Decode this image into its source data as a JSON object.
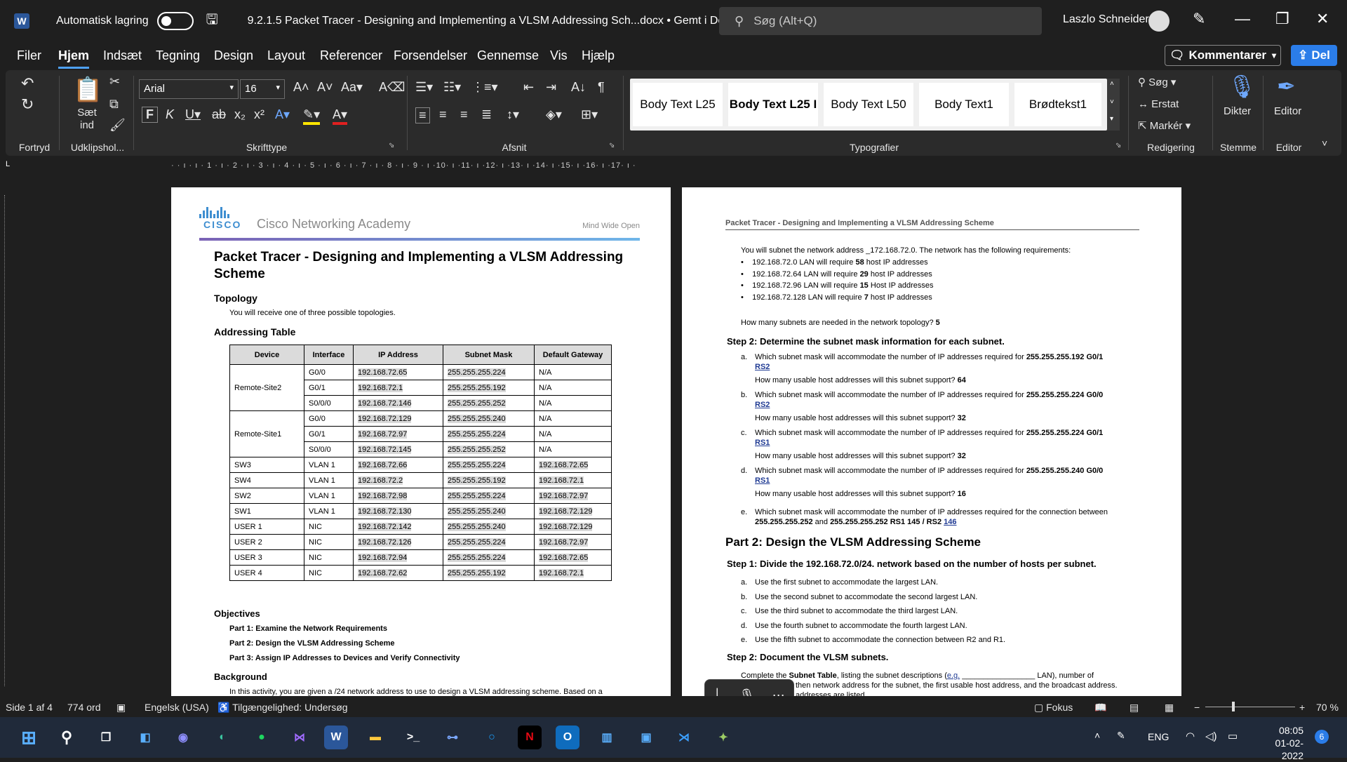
{
  "titlebar": {
    "autosave": "Automatisk lagring",
    "doc_title": "9.2.1.5 Packet Tracer - Designing and Implementing a VLSM Addressing Sch...docx • Gemt i Denne pc",
    "search_placeholder": "Søg (Alt+Q)",
    "user": "Laszlo Schneider"
  },
  "menu": {
    "tabs": [
      "Filer",
      "Hjem",
      "Indsæt",
      "Tegning",
      "Design",
      "Layout",
      "Referencer",
      "Forsendelser",
      "Gennemse",
      "Vis",
      "Hjælp"
    ],
    "comments": "Kommentarer",
    "share": "Del"
  },
  "ribbon": {
    "groups": {
      "undo": "Fortryd",
      "clipboard": "Udklipshol...",
      "font": "Skrifttype",
      "paragraph": "Afsnit",
      "styles": "Typografier",
      "editing": "Redigering",
      "voice": "Stemme",
      "editor": "Editor"
    },
    "paste": "Sæt ind",
    "font_name": "Arial",
    "font_size": "16",
    "styles": [
      "Body Text L25",
      "Body Text L25 I",
      "Body Text L50",
      "Body Text1",
      "Brødtekst1"
    ],
    "find": "Søg",
    "replace": "Erstat",
    "select": "Markér",
    "dictate": "Dikter",
    "editor_btn": "Editor"
  },
  "ruler": {
    "h": "· · ı · ı · 1 · ı · 2 · ı · 3 · ı · 4 · ı · 5 · ı · 6 · ı · 7 · ı · 8 · ı · 9 · ı ·10· ı ·11· ı ·12· ı ·13· ı ·14· ı ·15· ı ·16· ı ·17· ı ·"
  },
  "page1": {
    "brand": "CISCO",
    "academy": "Cisco Networking Academy",
    "mwo": "Mind Wide Open",
    "title": "Packet Tracer - Designing and Implementing a VLSM Addressing Scheme",
    "topology_h": "Topology",
    "topology_t": "You will receive one of three possible topologies.",
    "addr_h": "Addressing Table",
    "table": {
      "headers": [
        "Device",
        "Interface",
        "IP Address",
        "Subnet Mask",
        "Default Gateway"
      ],
      "rows": [
        {
          "device": "Remote-Site2",
          "interface": "G0/0",
          "ip": "192.168.72.65",
          "mask": "255.255.255.224",
          "gw": "N/A"
        },
        {
          "device": "",
          "interface": "G0/1",
          "ip": "192.168.72.1",
          "mask": "255.255.255.192",
          "gw": "N/A"
        },
        {
          "device": "",
          "interface": "S0/0/0",
          "ip": "192.168.72.146",
          "mask": "255.255.255.252",
          "gw": "N/A"
        },
        {
          "device": "Remote-Site1",
          "interface": "G0/0",
          "ip": "192.168.72.129",
          "mask": "255.255.255.240",
          "gw": "N/A"
        },
        {
          "device": "",
          "interface": "G0/1",
          "ip": "192.168.72.97",
          "mask": "255.255.255.224",
          "gw": "N/A"
        },
        {
          "device": "",
          "interface": "S0/0/0",
          "ip": "192.168.72.145",
          "mask": "255.255.255.252",
          "gw": "N/A"
        },
        {
          "device": "SW3",
          "interface": "VLAN 1",
          "ip": "192.168.72.66",
          "mask": "255.255.255.224",
          "gw": "192.168.72.65"
        },
        {
          "device": "SW4",
          "interface": "VLAN 1",
          "ip": "192.168.72.2",
          "mask": "255.255.255.192",
          "gw": "192.168.72.1"
        },
        {
          "device": "SW2",
          "interface": "VLAN 1",
          "ip": "192.168.72.98",
          "mask": "255.255.255.224",
          "gw": "192.168.72.97"
        },
        {
          "device": "SW1",
          "interface": "VLAN 1",
          "ip": "192.168.72.130",
          "mask": "255.255.255.240",
          "gw": "192.168.72.129"
        },
        {
          "device": "USER 1",
          "interface": "NIC",
          "ip": "192.168.72.142",
          "mask": "255.255.255.240",
          "gw": "192.168.72.129"
        },
        {
          "device": "USER 2",
          "interface": "NIC",
          "ip": "192.168.72.126",
          "mask": "255.255.255.224",
          "gw": "192.168.72.97"
        },
        {
          "device": "USER 3",
          "interface": "NIC",
          "ip": "192.168.72.94",
          "mask": "255.255.255.224",
          "gw": "192.168.72.65"
        },
        {
          "device": "USER 4",
          "interface": "NIC",
          "ip": "192.168.72.62",
          "mask": "255.255.255.192",
          "gw": "192.168.72.1"
        }
      ]
    },
    "objectives_h": "Objectives",
    "objectives": [
      "Part 1: Examine the Network Requirements",
      "Part 2: Design the VLSM Addressing Scheme",
      "Part 3: Assign IP Addresses to Devices and Verify Connectivity"
    ],
    "background_h": "Background",
    "background_t": "In this activity, you are given a /24 network address to use to design a VLSM addressing scheme. Based on a"
  },
  "page2": {
    "header": "Packet Tracer - Designing and Implementing a VLSM Addressing Scheme",
    "intro": "You will subnet the network address _172.168.72.0. The network has the following requirements:",
    "reqs": [
      {
        "pre": "192.168.72.0 LAN will require ",
        "num": "58",
        "post": " host IP addresses"
      },
      {
        "pre": "192.168.72.64 LAN will require ",
        "num": "29",
        "post": " host IP addresses"
      },
      {
        "pre": "192.168.72.96 LAN will require ",
        "num": "15",
        "post": " Host IP addresses"
      },
      {
        "pre": "192.168.72.128 LAN will require ",
        "num": "7",
        "post": " host IP addresses"
      }
    ],
    "subnets_q": "How many subnets are needed in the network topology? ",
    "subnets_a": "5",
    "step2": "Step 2:    Determine the subnet mask information for each subnet.",
    "qs": [
      {
        "letter": "a.",
        "text": "Which subnet mask will accommodate the number of IP addresses required for ",
        "ans": "255.255.255.192 G0/1",
        "link": "RS2",
        "usable_q": "How many usable host addresses will this subnet support? ",
        "usable_a": "64"
      },
      {
        "letter": "b.",
        "text": "Which subnet mask will accommodate the number of IP addresses required for ",
        "ans": "255.255.255.224 G0/0",
        "link": "RS2",
        "usable_q": "How many usable host addresses will this subnet support? ",
        "usable_a": "32"
      },
      {
        "letter": "c.",
        "text": "Which subnet mask will accommodate the number of IP addresses required for ",
        "ans": "255.255.255.224 G0/1",
        "link": "RS1",
        "usable_q": "How many usable host addresses will this subnet support? ",
        "usable_a": "32"
      },
      {
        "letter": "d.",
        "text": "Which subnet mask will accommodate the number of IP addresses required for ",
        "ans": "255.255.255.240 G0/0",
        "link": "RS1",
        "usable_q": "How many usable host addresses will this subnet support? ",
        "usable_a": "16"
      }
    ],
    "qe": {
      "letter": "e.",
      "text": "Which subnet mask will accommodate the number of IP addresses required for the connection between",
      "ans": "255.255.255.252",
      "mid": " and ",
      "ans2": "255.255.255.252 RS1 145 / RS2 ",
      "link": "146"
    },
    "part2": "Part 2:  Design the VLSM Addressing Scheme",
    "step1": "Step 1:    Divide the 192.168.72.0/24. network based on the number of hosts per subnet.",
    "items": [
      {
        "l": "a.",
        "t": "Use the first subnet to accommodate the largest LAN."
      },
      {
        "l": "b.",
        "t": "Use the second subnet to accommodate the second largest LAN."
      },
      {
        "l": "c.",
        "t": "Use the third subnet to accommodate the third largest LAN."
      },
      {
        "l": "d.",
        "t": "Use the fourth subnet to accommodate the fourth largest LAN."
      },
      {
        "l": "e.",
        "t": "Use the fifth subnet to accommodate the connection between R2 and R1."
      }
    ],
    "step2b": "Step 2:    Document the VLSM subnets.",
    "doc1a": "Complete the ",
    "doc1b": "Subnet Table",
    "doc1c": ", listing the subnet descriptions (",
    "doc1d": "e.g.",
    "doc1e": " _________________ LAN), number of",
    "doc2": "then network address for the subnet, the first usable host address, and the broadcast address.",
    "doc3": "addresses are listed."
  },
  "status": {
    "page": "Side 1 af 4",
    "words": "774 ord",
    "lang": "Engelsk (USA)",
    "access": "Tilgængelighed: Undersøg",
    "focus": "Fokus",
    "zoom": "70 %"
  },
  "taskbar": {
    "lang": "ENG",
    "time": "08:05",
    "date": "01-02-2022",
    "badge": "6"
  },
  "colors": {
    "accent": "#2b7de9",
    "word": "#2b579a",
    "cisco": "#3e8ed0"
  }
}
